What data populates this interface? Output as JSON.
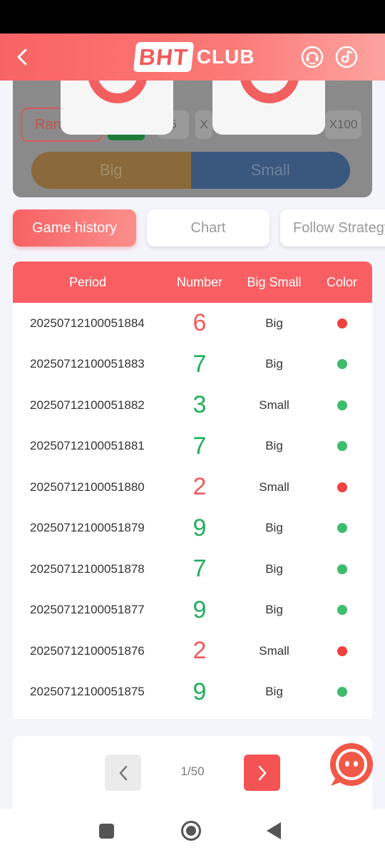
{
  "header": {
    "logo_bht": "BHT",
    "logo_club": "CLUB"
  },
  "game_panel": {
    "random_label": "Ran",
    "multipliers": [
      "5",
      "X",
      "X100"
    ],
    "big_label": "Big",
    "small_label": "Small"
  },
  "tabs": [
    {
      "label": "Game history",
      "active": true
    },
    {
      "label": "Chart",
      "active": false
    },
    {
      "label": "Follow Strategy",
      "active": false
    }
  ],
  "table": {
    "headers": {
      "period": "Period",
      "number": "Number",
      "big_small": "Big Small",
      "color": "Color"
    },
    "rows": [
      {
        "period": "20250712100051884",
        "number": "6",
        "number_color": "#f25a5a",
        "big_small": "Big",
        "dot_color": "#f04040"
      },
      {
        "period": "20250712100051883",
        "number": "7",
        "number_color": "#1fae5c",
        "big_small": "Big",
        "dot_color": "#3cbc6c"
      },
      {
        "period": "20250712100051882",
        "number": "3",
        "number_color": "#1fae5c",
        "big_small": "Small",
        "dot_color": "#3cbc6c"
      },
      {
        "period": "20250712100051881",
        "number": "7",
        "number_color": "#1fae5c",
        "big_small": "Big",
        "dot_color": "#3cbc6c"
      },
      {
        "period": "20250712100051880",
        "number": "2",
        "number_color": "#f25a5a",
        "big_small": "Small",
        "dot_color": "#f04040"
      },
      {
        "period": "20250712100051879",
        "number": "9",
        "number_color": "#1fae5c",
        "big_small": "Big",
        "dot_color": "#3cbc6c"
      },
      {
        "period": "20250712100051878",
        "number": "7",
        "number_color": "#1fae5c",
        "big_small": "Big",
        "dot_color": "#3cbc6c"
      },
      {
        "period": "20250712100051877",
        "number": "9",
        "number_color": "#1fae5c",
        "big_small": "Big",
        "dot_color": "#3cbc6c"
      },
      {
        "period": "20250712100051876",
        "number": "2",
        "number_color": "#f25a5a",
        "big_small": "Small",
        "dot_color": "#f04040"
      },
      {
        "period": "20250712100051875",
        "number": "9",
        "number_color": "#1fae5c",
        "big_small": "Big",
        "dot_color": "#3cbc6c"
      }
    ]
  },
  "pagination": {
    "text": "1/50"
  },
  "colors": {
    "accent": "#f95f62",
    "green": "#1fae5c",
    "red": "#f25a5a"
  }
}
